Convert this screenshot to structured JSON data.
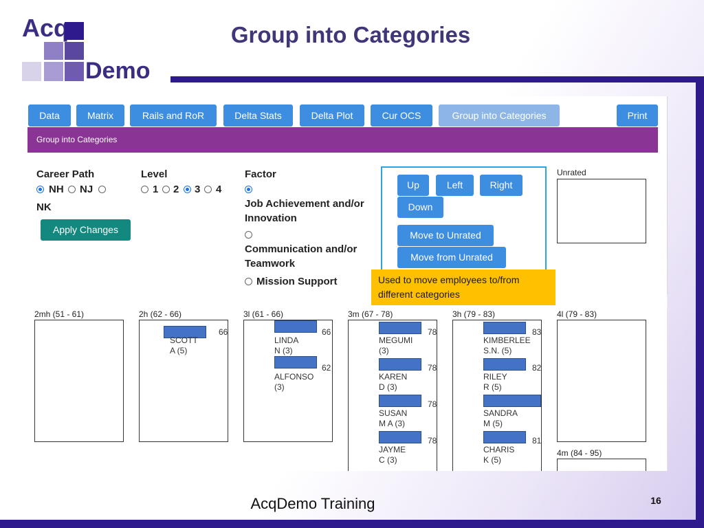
{
  "slide": {
    "title": "Group into Categories",
    "footer": "AcqDemo Training",
    "page_number": "16",
    "logo": {
      "line1": "Acq",
      "line2": "Demo"
    },
    "colors": {
      "brand_dark": "#2e1a8c",
      "title": "#3f3778",
      "tab_blue": "#3d8ee0",
      "purple_bar": "#8a3596",
      "apply_green": "#13887e",
      "callout": "#ffc000",
      "redaction": "#4472c4"
    }
  },
  "tabs": [
    {
      "label": "Data"
    },
    {
      "label": "Matrix"
    },
    {
      "label": "Rails and RoR"
    },
    {
      "label": "Delta Stats"
    },
    {
      "label": "Delta Plot"
    },
    {
      "label": "Cur OCS"
    },
    {
      "label": "Group into Categories",
      "active": true
    },
    {
      "label": "Print"
    }
  ],
  "section_header": "Group into Categories",
  "career_path": {
    "label": "Career Path",
    "options": [
      {
        "label": "NH",
        "selected": true
      },
      {
        "label": "NJ",
        "selected": false
      },
      {
        "label": "NK",
        "selected": false
      }
    ]
  },
  "level": {
    "label": "Level",
    "options": [
      {
        "label": "1",
        "selected": false
      },
      {
        "label": "2",
        "selected": false
      },
      {
        "label": "3",
        "selected": true
      },
      {
        "label": "4",
        "selected": false
      }
    ]
  },
  "factor": {
    "label": "Factor",
    "options": [
      {
        "label_line1": "Job Achievement and/or",
        "label_line2": "Innovation",
        "selected": true
      },
      {
        "label_line1": "Communication and/or",
        "label_line2": "Teamwork",
        "selected": false
      },
      {
        "label_line1": "Mission Support",
        "selected": false
      }
    ]
  },
  "apply_button": "Apply Changes",
  "move_controls": {
    "up": "Up",
    "left": "Left",
    "right": "Right",
    "down": "Down",
    "move_to_unrated": "Move to Unrated",
    "move_from_unrated": "Move from Unrated"
  },
  "unrated_label": "Unrated",
  "callout": "Used to move employees to/from different categories",
  "categories": [
    {
      "label": "2mh (51 - 61)",
      "employees": []
    },
    {
      "label": "2h (62 - 66)",
      "employees": [
        {
          "first": "SCOTT",
          "second": "A (5)",
          "score": "66"
        }
      ]
    },
    {
      "label": "3l (61 - 66)",
      "employees": [
        {
          "first": "LINDA",
          "second": "N (3)",
          "score": "66"
        },
        {
          "first": "ALFONSO",
          "second": "(3)",
          "score": "62"
        }
      ]
    },
    {
      "label": "3m (67 - 78)",
      "employees": [
        {
          "first": "MEGUMI",
          "second": "(3)",
          "score": "78"
        },
        {
          "first": "KAREN",
          "second": "D (3)",
          "score": "78"
        },
        {
          "first": "SUSAN",
          "second": "M A (3)",
          "score": "78"
        },
        {
          "first": "JAYME",
          "second": "C (3)",
          "score": "78"
        }
      ]
    },
    {
      "label": "3h (79 - 83)",
      "employees": [
        {
          "first": "KIMBERLEE",
          "second": "S.N. (5)",
          "score": "83"
        },
        {
          "first": "RILEY",
          "second": "R (5)",
          "score": "82"
        },
        {
          "first": "SANDRA",
          "second": "M (5)",
          "score": ""
        },
        {
          "first": "CHARIS",
          "second": "K (5)",
          "score": "81"
        }
      ]
    },
    {
      "label": "4l (79 - 83)",
      "employees": []
    },
    {
      "label": "4m (84 - 95)",
      "employees": []
    }
  ]
}
